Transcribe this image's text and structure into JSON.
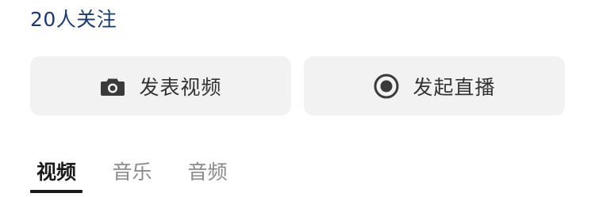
{
  "profile": {
    "followers_text": "20人关注"
  },
  "actions": {
    "publish_video": {
      "label": "发表视频",
      "icon": "camera-icon"
    },
    "start_live": {
      "label": "发起直播",
      "icon": "live-record-icon"
    }
  },
  "tabs": [
    {
      "label": "视频",
      "selected": true
    },
    {
      "label": "音乐",
      "selected": false
    },
    {
      "label": "音频",
      "selected": false
    }
  ],
  "colors": {
    "follow_text": "#1c3a6e",
    "button_bg": "#f2f2f2",
    "button_text": "#333333",
    "tab_active": "#1a1a1a",
    "tab_inactive": "#8a8a8a"
  }
}
